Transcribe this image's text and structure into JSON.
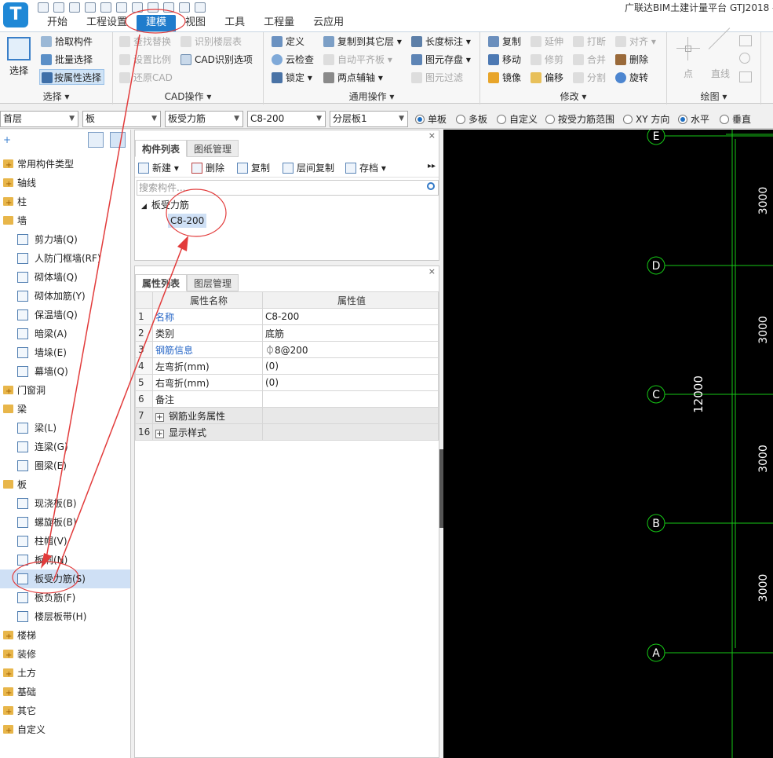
{
  "window": {
    "logo_letter": "T",
    "title": "广联达BIM土建计量平台 GTJ2018 -"
  },
  "ribbon_tabs": [
    "开始",
    "工程设置",
    "建模",
    "视图",
    "工具",
    "工程量",
    "云应用"
  ],
  "ribbon": {
    "select_big": "选择",
    "select_group": {
      "title": "选择",
      "items": [
        "拾取构件",
        "批量选择",
        "按属性选择"
      ]
    },
    "cad_group": {
      "title": "CAD操作",
      "items": [
        "查找替换",
        "识别楼层表",
        "设置比例",
        "CAD识别选项",
        "还原CAD"
      ]
    },
    "common_group": {
      "title": "通用操作",
      "items": [
        "定义",
        "复制到其它层",
        "长度标注",
        "云检查",
        "自动平齐板",
        "图元存盘",
        "锁定",
        "两点辅轴",
        "图元过滤"
      ]
    },
    "modify_group": {
      "title": "修改",
      "items": [
        "复制",
        "延伸",
        "打断",
        "对齐",
        "移动",
        "修剪",
        "合并",
        "删除",
        "镜像",
        "偏移",
        "分割",
        "旋转"
      ]
    },
    "draw_group": {
      "title": "绘图",
      "items": [
        "点",
        "直线"
      ]
    }
  },
  "filterbar": {
    "floor": "首层",
    "category": "板",
    "component_type": "板受力筋",
    "component": "C8-200",
    "layer": "分层板1",
    "radios": [
      {
        "label": "单板",
        "checked": true
      },
      {
        "label": "多板",
        "checked": false
      },
      {
        "label": "自定义",
        "checked": false
      },
      {
        "label": "按受力筋范围",
        "checked": false
      },
      {
        "label": "XY 方向",
        "checked": false
      },
      {
        "label": "水平",
        "checked": true
      },
      {
        "label": "垂直",
        "checked": false
      }
    ]
  },
  "nav": {
    "items": [
      {
        "label": "常用构件类型",
        "level": "cat"
      },
      {
        "label": "轴线",
        "level": "cat"
      },
      {
        "label": "柱",
        "level": "cat"
      },
      {
        "label": "墙",
        "level": "cat"
      },
      {
        "label": "剪力墙(Q)",
        "level": "sub"
      },
      {
        "label": "人防门框墙(RF)",
        "level": "sub"
      },
      {
        "label": "砌体墙(Q)",
        "level": "sub"
      },
      {
        "label": "砌体加筋(Y)",
        "level": "sub"
      },
      {
        "label": "保温墙(Q)",
        "level": "sub"
      },
      {
        "label": "暗梁(A)",
        "level": "sub"
      },
      {
        "label": "墙垛(E)",
        "level": "sub"
      },
      {
        "label": "幕墙(Q)",
        "level": "sub"
      },
      {
        "label": "门窗洞",
        "level": "cat"
      },
      {
        "label": "梁",
        "level": "cat"
      },
      {
        "label": "梁(L)",
        "level": "sub"
      },
      {
        "label": "连梁(G)",
        "level": "sub"
      },
      {
        "label": "圈梁(E)",
        "level": "sub"
      },
      {
        "label": "板",
        "level": "cat"
      },
      {
        "label": "现浇板(B)",
        "level": "sub"
      },
      {
        "label": "螺旋板(B)",
        "level": "sub"
      },
      {
        "label": "柱帽(V)",
        "level": "sub"
      },
      {
        "label": "板洞(N)",
        "level": "sub"
      },
      {
        "label": "板受力筋(S)",
        "level": "sub",
        "selected": true
      },
      {
        "label": "板负筋(F)",
        "level": "sub"
      },
      {
        "label": "楼层板带(H)",
        "level": "sub"
      },
      {
        "label": "楼梯",
        "level": "cat"
      },
      {
        "label": "装修",
        "level": "cat"
      },
      {
        "label": "土方",
        "level": "cat"
      },
      {
        "label": "基础",
        "level": "cat"
      },
      {
        "label": "其它",
        "level": "cat"
      },
      {
        "label": "自定义",
        "level": "cat"
      }
    ]
  },
  "component_list": {
    "tabs": [
      "构件列表",
      "图纸管理"
    ],
    "toolbar": [
      "新建",
      "删除",
      "复制",
      "层间复制",
      "存档"
    ],
    "search_placeholder": "搜索构件...",
    "tree_root": "板受力筋",
    "tree_leaf": "C8-200"
  },
  "property_list": {
    "tabs": [
      "属性列表",
      "图层管理"
    ],
    "col_name": "属性名称",
    "col_value": "属性值",
    "rows": [
      {
        "idx": "1",
        "name": "名称",
        "value": "C8-200",
        "blue": true
      },
      {
        "idx": "2",
        "name": "类别",
        "value": "底筋",
        "blue": false
      },
      {
        "idx": "3",
        "name": "钢筋信息",
        "value": "⏀8@200",
        "blue": true
      },
      {
        "idx": "4",
        "name": "左弯折(mm)",
        "value": "(0)",
        "blue": false
      },
      {
        "idx": "5",
        "name": "右弯折(mm)",
        "value": "(0)",
        "blue": false
      },
      {
        "idx": "6",
        "name": "备注",
        "value": "",
        "blue": false
      },
      {
        "idx": "7",
        "name": "钢筋业务属性",
        "value": "",
        "group": true
      },
      {
        "idx": "16",
        "name": "显示样式",
        "value": "",
        "group": true
      }
    ]
  },
  "canvas": {
    "axes": [
      "E",
      "D",
      "C",
      "B",
      "A"
    ],
    "dims": [
      "3000",
      "3000",
      "3000",
      "3000"
    ],
    "total": "12000"
  },
  "colors": {
    "accent": "#1f7ccc",
    "selection": "#cfe0f5",
    "canvas_bg": "#000000",
    "grid_line": "#16c816",
    "annotation": "#e23b3b"
  }
}
